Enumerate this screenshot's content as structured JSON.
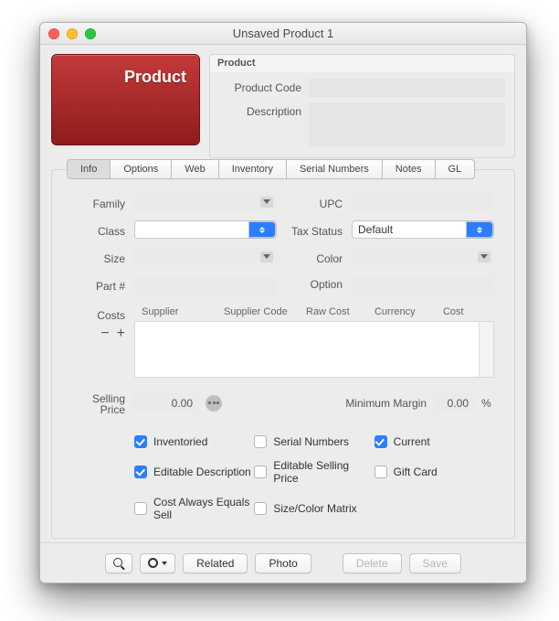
{
  "window": {
    "title": "Unsaved Product 1"
  },
  "tile": {
    "label": "Product"
  },
  "product_group": {
    "title": "Product",
    "code_label": "Product Code",
    "desc_label": "Description",
    "code_value": "",
    "desc_value": ""
  },
  "tabs": [
    "Info",
    "Options",
    "Web",
    "Inventory",
    "Serial Numbers",
    "Notes",
    "GL"
  ],
  "active_tab": "Info",
  "info": {
    "family_label": "Family",
    "family_value": "",
    "upc_label": "UPC",
    "upc_value": "",
    "class_label": "Class",
    "class_value": "",
    "tax_label": "Tax Status",
    "tax_value": "Default",
    "size_label": "Size",
    "size_value": "",
    "color_label": "Color",
    "color_value": "",
    "part_label": "Part #",
    "part_value": "",
    "option_label": "Option",
    "option_value": ""
  },
  "costs": {
    "label": "Costs",
    "headers": [
      "Supplier",
      "Supplier Code",
      "Raw Cost",
      "Currency",
      "Cost"
    ],
    "rows": []
  },
  "selling": {
    "label": "Selling\nPrice",
    "price": "0.00",
    "min_margin_label": "Minimum Margin",
    "min_margin": "0.00",
    "pct": "%"
  },
  "checks": {
    "inventoried": {
      "label": "Inventoried",
      "checked": true
    },
    "serial": {
      "label": "Serial Numbers",
      "checked": false
    },
    "current": {
      "label": "Current",
      "checked": true
    },
    "editable_desc": {
      "label": "Editable Description",
      "checked": true
    },
    "editable_sell": {
      "label": "Editable Selling Price",
      "checked": false
    },
    "gift": {
      "label": "Gift Card",
      "checked": false
    },
    "cost_eq": {
      "label": "Cost Always Equals Sell",
      "checked": false
    },
    "matrix": {
      "label": "Size/Color Matrix",
      "checked": false
    }
  },
  "footer": {
    "related": "Related",
    "photo": "Photo",
    "delete": "Delete",
    "save": "Save"
  }
}
